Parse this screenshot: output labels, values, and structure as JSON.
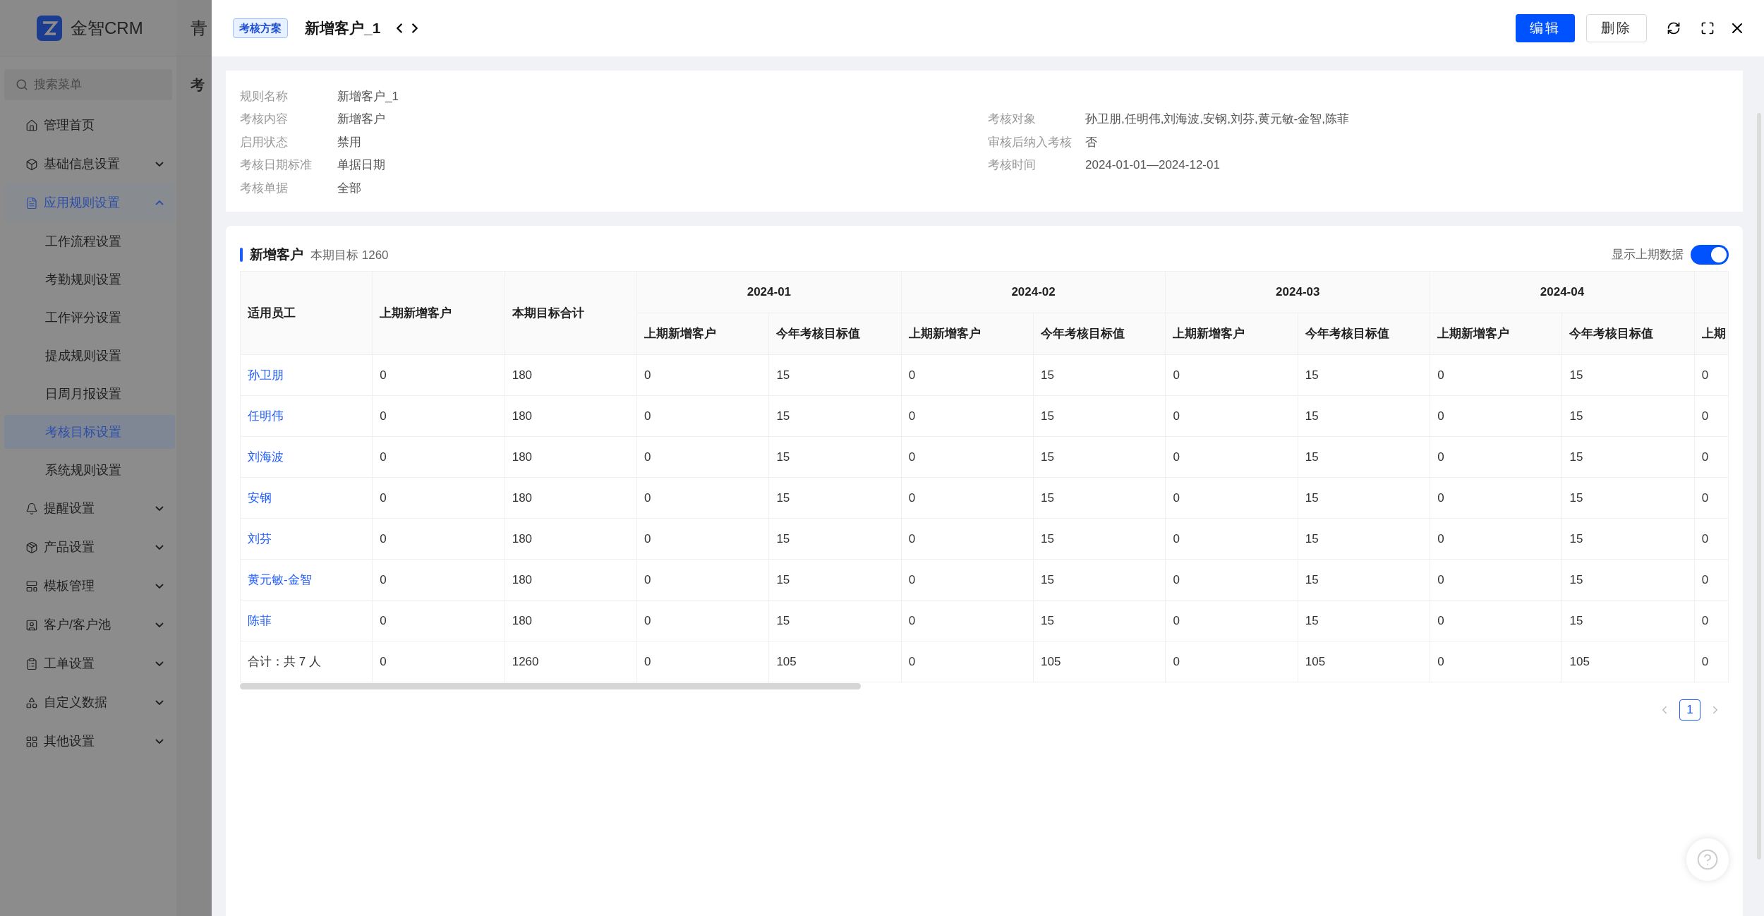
{
  "background": {
    "brand": "金智CRM",
    "header_text": "青",
    "page_title": "考"
  },
  "sidebar": {
    "search": {
      "placeholder": "搜索菜单"
    },
    "items": [
      {
        "label": "管理首页",
        "expandable": false,
        "selected": false
      },
      {
        "label": "基础信息设置",
        "expandable": true,
        "expanded": false,
        "selected": false
      },
      {
        "label": "应用规则设置",
        "expandable": true,
        "expanded": true,
        "selected": true,
        "children": [
          {
            "label": "工作流程设置",
            "selected": false
          },
          {
            "label": "考勤规则设置",
            "selected": false
          },
          {
            "label": "工作评分设置",
            "selected": false
          },
          {
            "label": "提成规则设置",
            "selected": false
          },
          {
            "label": "日周月报设置",
            "selected": false
          },
          {
            "label": "考核目标设置",
            "selected": true
          },
          {
            "label": "系统规则设置",
            "selected": false
          }
        ]
      },
      {
        "label": "提醒设置",
        "expandable": true,
        "expanded": false,
        "selected": false
      },
      {
        "label": "产品设置",
        "expandable": true,
        "expanded": false,
        "selected": false
      },
      {
        "label": "模板管理",
        "expandable": true,
        "expanded": false,
        "selected": false
      },
      {
        "label": "客户/客户池",
        "expandable": true,
        "expanded": false,
        "selected": false
      },
      {
        "label": "工单设置",
        "expandable": true,
        "expanded": false,
        "selected": false
      },
      {
        "label": "自定义数据",
        "expandable": true,
        "expanded": false,
        "selected": false
      },
      {
        "label": "其他设置",
        "expandable": true,
        "expanded": false,
        "selected": false
      }
    ]
  },
  "drawer": {
    "tag": "考核方案",
    "title": "新增客户_1",
    "buttons": [
      {
        "label": "编辑",
        "kind": "primary"
      },
      {
        "label": "删除",
        "kind": "default"
      }
    ]
  },
  "details": {
    "left": [
      {
        "label": "规则名称",
        "value": "新增客户_1"
      },
      {
        "label": "考核内容",
        "value": "新增客户"
      },
      {
        "label": "启用状态",
        "value": "禁用"
      },
      {
        "label": "考核日期标准",
        "value": "单据日期"
      },
      {
        "label": "考核单据",
        "value": "全部"
      }
    ],
    "right": [
      {
        "label": "考核对象",
        "value": "孙卫朋,任明伟,刘海波,安钢,刘芬,黄元敏-金智,陈菲"
      },
      {
        "label": "审核后纳入考核",
        "value": "否"
      },
      {
        "label": "考核时间",
        "value": "2024-01-01—2024-12-01"
      }
    ]
  },
  "section": {
    "title": "新增客户",
    "subtitle": "本期目标 1260",
    "toggle": {
      "label": "显示上期数据",
      "on": true
    }
  },
  "table": {
    "fixed_columns": [
      "适用员工",
      "上期新增客户",
      "本期目标合计"
    ],
    "months": [
      {
        "label": "2024-01",
        "columns": [
          "上期新增客户",
          "今年考核目标值"
        ]
      },
      {
        "label": "2024-02",
        "columns": [
          "上期新增客户",
          "今年考核目标值"
        ]
      },
      {
        "label": "2024-03",
        "columns": [
          "上期新增客户",
          "今年考核目标值"
        ]
      },
      {
        "label": "2024-04",
        "columns": [
          "上期新增客户",
          "今年考核目标值"
        ]
      }
    ],
    "cut_column": "上期",
    "rows": [
      {
        "name": "孙卫朋",
        "cells": [
          "0",
          "180",
          "0",
          "15",
          "0",
          "15",
          "0",
          "15",
          "0",
          "15",
          "0"
        ]
      },
      {
        "name": "任明伟",
        "cells": [
          "0",
          "180",
          "0",
          "15",
          "0",
          "15",
          "0",
          "15",
          "0",
          "15",
          "0"
        ]
      },
      {
        "name": "刘海波",
        "cells": [
          "0",
          "180",
          "0",
          "15",
          "0",
          "15",
          "0",
          "15",
          "0",
          "15",
          "0"
        ]
      },
      {
        "name": "安钢",
        "cells": [
          "0",
          "180",
          "0",
          "15",
          "0",
          "15",
          "0",
          "15",
          "0",
          "15",
          "0"
        ]
      },
      {
        "name": "刘芬",
        "cells": [
          "0",
          "180",
          "0",
          "15",
          "0",
          "15",
          "0",
          "15",
          "0",
          "15",
          "0"
        ]
      },
      {
        "name": "黄元敏-金智",
        "cells": [
          "0",
          "180",
          "0",
          "15",
          "0",
          "15",
          "0",
          "15",
          "0",
          "15",
          "0"
        ]
      },
      {
        "name": "陈菲",
        "cells": [
          "0",
          "180",
          "0",
          "15",
          "0",
          "15",
          "0",
          "15",
          "0",
          "15",
          "0"
        ]
      }
    ],
    "total": {
      "label": "合计：共 7 人",
      "cells": [
        "0",
        "1260",
        "0",
        "105",
        "0",
        "105",
        "0",
        "105",
        "0",
        "105",
        "0"
      ]
    }
  },
  "pagination": {
    "pages": [
      {
        "label": "1",
        "selected": true
      }
    ]
  }
}
